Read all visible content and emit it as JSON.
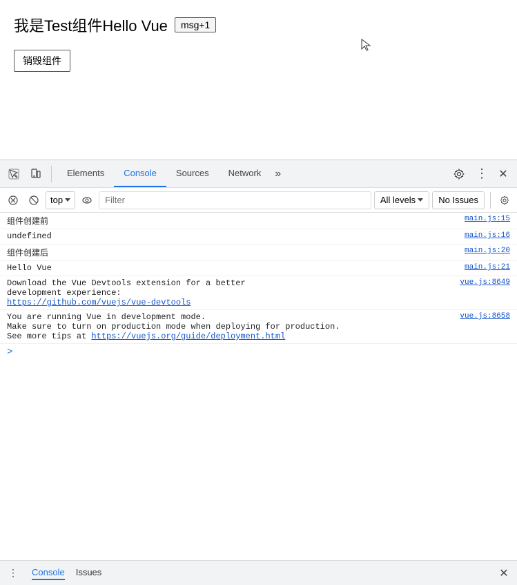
{
  "page": {
    "title": "我是Test组件Hello Vue",
    "msg_badge": "msg+1",
    "destroy_button": "销毁组件"
  },
  "devtools": {
    "tabs": [
      {
        "label": "Elements",
        "active": false
      },
      {
        "label": "Console",
        "active": true
      },
      {
        "label": "Sources",
        "active": false
      },
      {
        "label": "Network",
        "active": false
      },
      {
        "label": "»",
        "active": false
      }
    ],
    "console_toolbar": {
      "top_label": "top",
      "filter_placeholder": "Filter",
      "all_levels_label": "All levels",
      "no_issues_label": "No Issues"
    },
    "console_rows": [
      {
        "text": "组件创建前",
        "link": "main.js:15",
        "type": "normal"
      },
      {
        "text": "undefined",
        "link": "main.js:16",
        "type": "normal"
      },
      {
        "text": "组件创建后",
        "link": "main.js:20",
        "type": "normal"
      },
      {
        "text": "Hello Vue",
        "link": "main.js:21",
        "type": "normal"
      }
    ],
    "console_multi_rows": [
      {
        "text": "Download the Vue Devtools extension for a better\ndevelopment experience:\n",
        "link_text": "https://github.com/vuejs/vue-devtools",
        "link_href": "https://github.com/vuejs/vue-devtools",
        "file_link": "vue.js:8649"
      },
      {
        "text": "You are running Vue in development mode.\nMake sure to turn on production mode when deploying for production.\nSee more tips at ",
        "link_text": "https://vuejs.org/guide/deployment.html",
        "link_href": "https://vuejs.org/guide/deployment.html",
        "file_link": "vue.js:8658"
      }
    ],
    "prompt_symbol": ">"
  },
  "status_bar": {
    "dots_icon": "⋮",
    "tabs": [
      {
        "label": "Console",
        "active": true
      },
      {
        "label": "Issues",
        "active": false
      }
    ],
    "close_label": "✕"
  }
}
